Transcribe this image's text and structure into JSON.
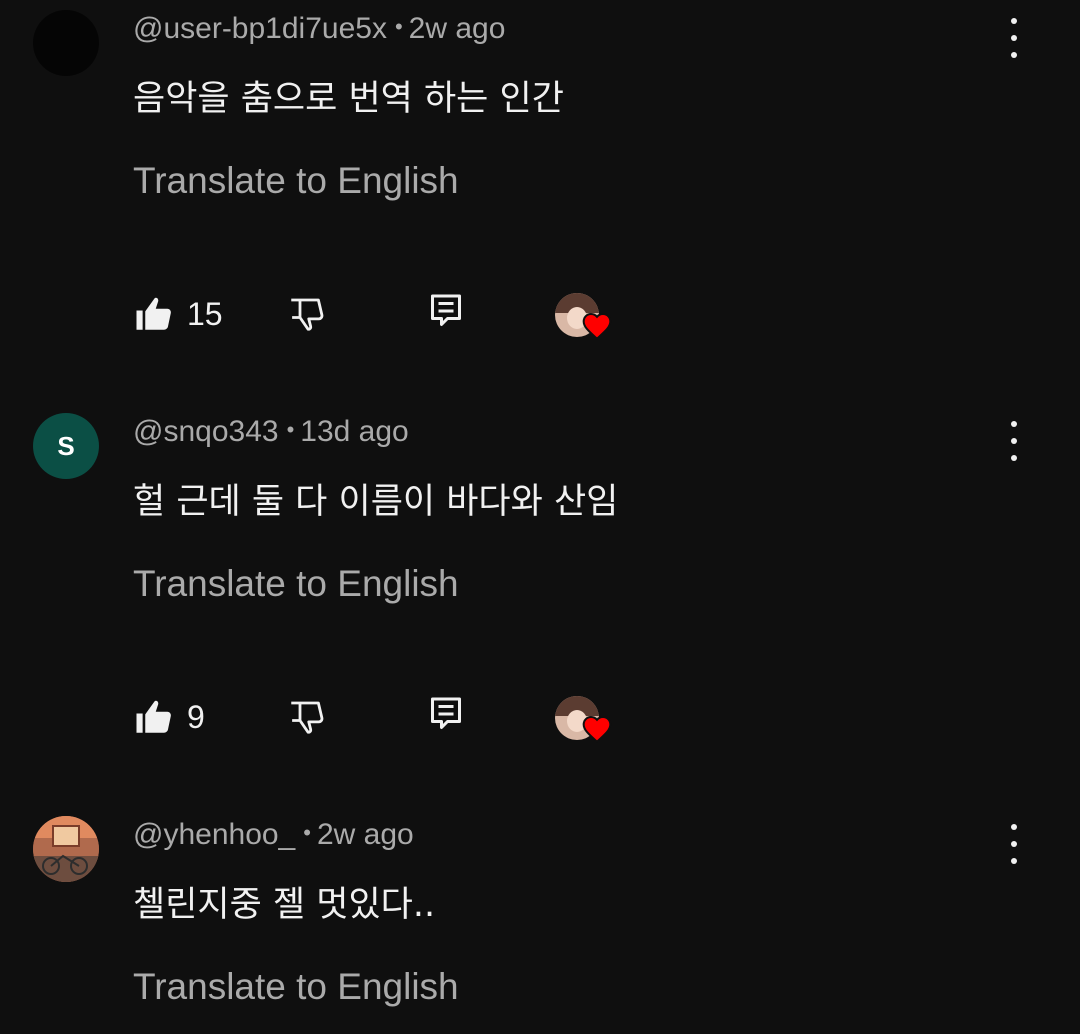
{
  "comments": [
    {
      "handle": "@user-bp1di7ue5x",
      "time": "2w ago",
      "text": "음악을 춤으로 번역 하는 인간",
      "translate_label": "Translate to English",
      "likes": "15",
      "avatar_letter": ""
    },
    {
      "handle": "@snqo343",
      "time": "13d ago",
      "text": "헐 근데 둘 다 이름이 바다와 산임",
      "translate_label": "Translate to English",
      "likes": "9",
      "avatar_letter": "S"
    },
    {
      "handle": "@yhenhoo_",
      "time": "2w ago",
      "text": "첼린지중 젤 멋있다..",
      "translate_label": "Translate to English",
      "likes": "",
      "avatar_letter": ""
    }
  ],
  "meta_separator": "•",
  "icons": {
    "like": "thumbs-up-icon",
    "dislike": "thumbs-down-icon",
    "reply": "reply-icon",
    "more": "more-vert-icon",
    "creator_heart": "creator-heart-icon"
  },
  "colors": {
    "background": "#0f0f0f",
    "primary_text": "#f1f1f1",
    "secondary_text": "#aaaaaa",
    "heart": "#ff0000",
    "avatar_s": "#0b4f45"
  }
}
